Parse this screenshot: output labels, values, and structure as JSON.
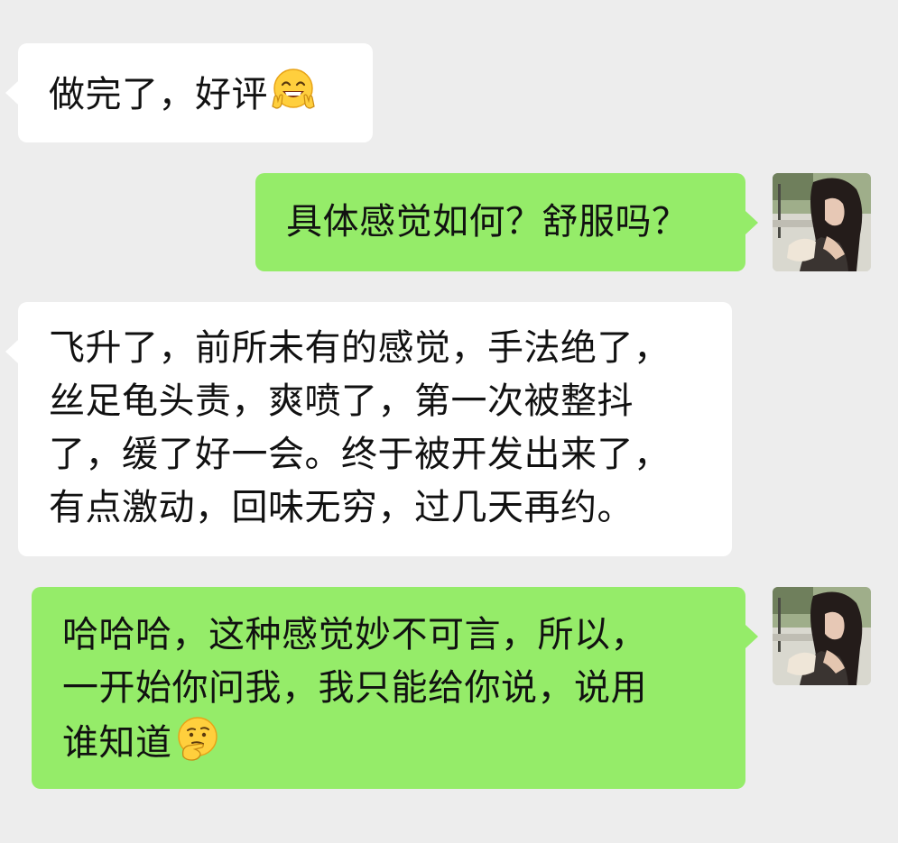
{
  "chat": {
    "messages": [
      {
        "direction": "incoming",
        "lines": [
          "做完了，好评"
        ],
        "emoji": "laughing-peace-sign-emoji"
      },
      {
        "direction": "outgoing",
        "lines": [
          "具体感觉如何？舒服吗？"
        ]
      },
      {
        "direction": "incoming",
        "lines": [
          "飞升了，前所未有的感觉，手法绝了，",
          "丝足龟头责，爽喷了，第一次被整抖",
          "了，缓了好一会。终于被开发出来了，",
          "有点激动，回味无穷，过几天再约。"
        ]
      },
      {
        "direction": "outgoing",
        "lines": [
          "哈哈哈，这种感觉妙不可言，所以，",
          "一开始你问我，我只能给你说，说用",
          "谁知道"
        ],
        "emoji": "thinking-face-emoji"
      }
    ]
  },
  "colors": {
    "background": "#ededed",
    "incoming_bubble": "#ffffff",
    "outgoing_bubble": "#95ec69",
    "text": "#111111"
  }
}
